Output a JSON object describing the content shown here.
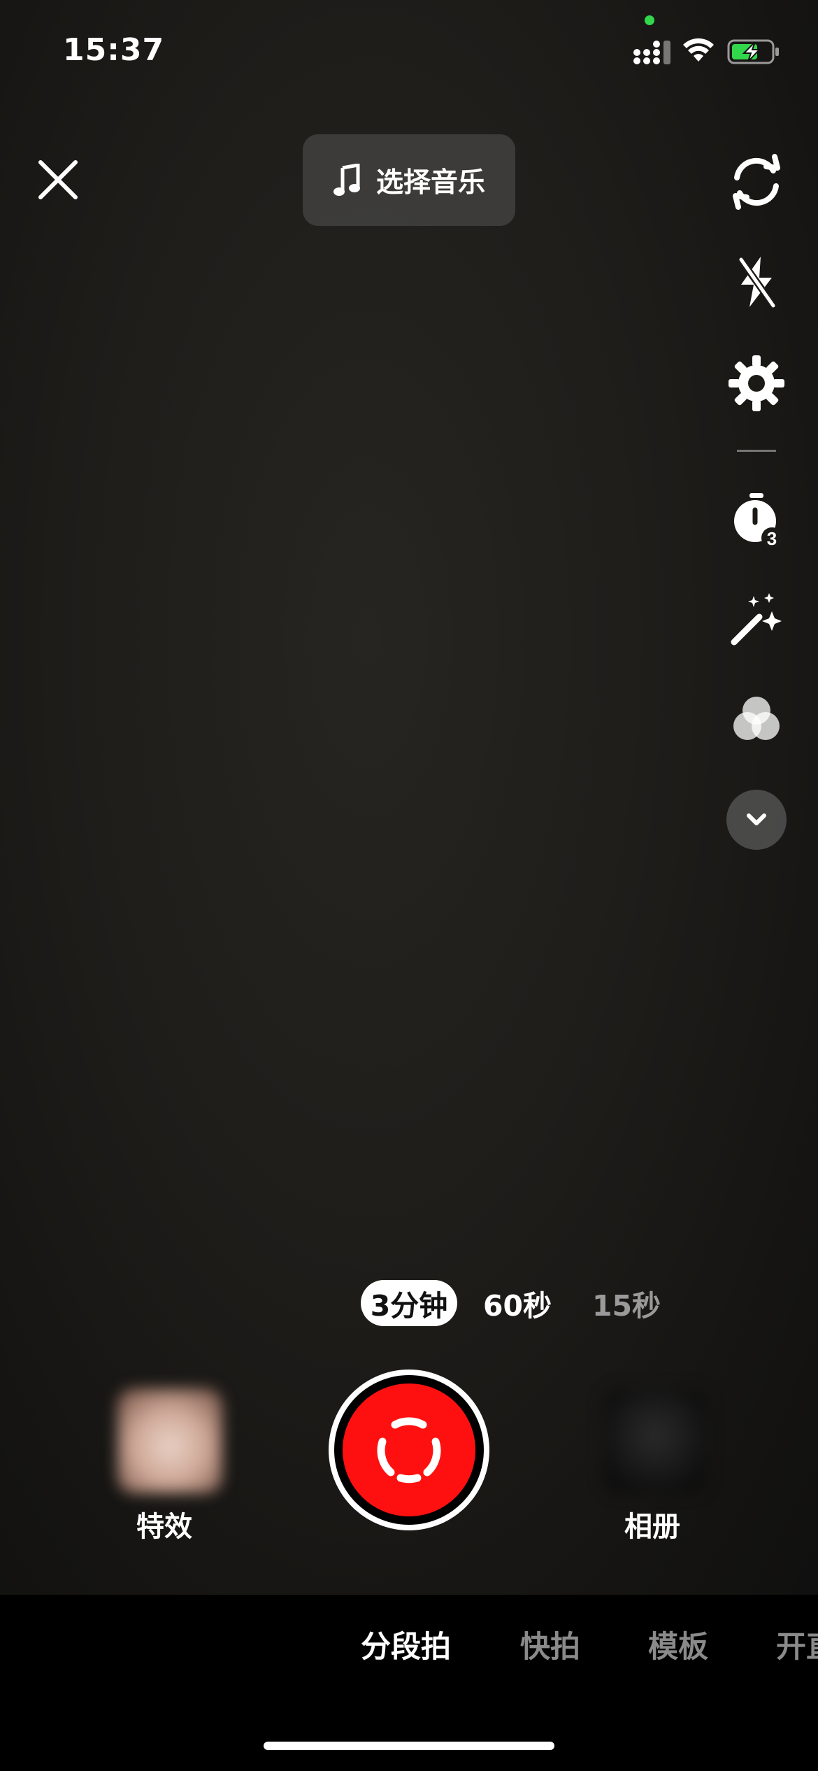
{
  "status_bar": {
    "time": "15:37"
  },
  "top_bar": {
    "music_button_label": "选择音乐"
  },
  "toolbar": {
    "icons": [
      "flip-camera-icon",
      "flash-off-icon",
      "settings-icon",
      "timer-icon",
      "beauty-wand-icon",
      "filter-icon",
      "chevron-down-icon"
    ],
    "timer_badge": "3"
  },
  "duration": {
    "options": [
      "3分钟",
      "60秒",
      "15秒"
    ],
    "selected": "3分钟"
  },
  "capture": {
    "effects_label": "特效",
    "album_label": "相册",
    "record_color": "#ff1010"
  },
  "modes": {
    "items": [
      "分段拍",
      "快拍",
      "模板",
      "开直"
    ],
    "selected": "分段拍"
  },
  "colors": {
    "accent_record": "#ff1010",
    "privacy_dot": "#32d74b",
    "battery_charging": "#32d74b"
  }
}
